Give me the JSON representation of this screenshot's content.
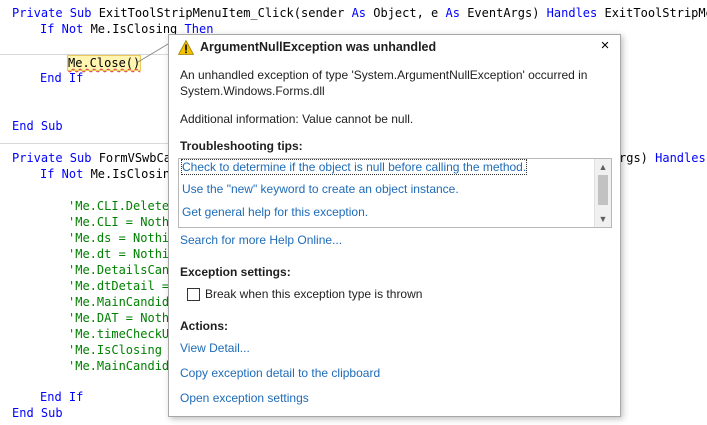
{
  "code": {
    "line1": {
      "kw1": "Private Sub",
      "name": " ExitToolStripMenuItem_Click(sender ",
      "kw2": "As",
      "t1": " Object, e ",
      "kw3": "As",
      "t2": " EventArgs) ",
      "kw4": "Handles",
      "t3": " ExitToolStripMenuI"
    },
    "line2": {
      "kw1": "If Not",
      "t1": " Me.IsClosing ",
      "kw2": "Then"
    },
    "line3": {
      "text": "Me.Close()"
    },
    "line4": {
      "kw": "End If"
    },
    "line5": {
      "kw": "End Sub"
    },
    "line6": {
      "kw1": "Private Sub",
      "name": " FormVSwbCar",
      "tail": "rgs) ",
      "kw2": "Handles"
    },
    "line7": {
      "kw1": "If Not",
      "t1": " Me.IsClosin"
    },
    "comments": [
      "'Me.CLI.Delete",
      "'Me.CLI = Nothi",
      "'Me.ds = Nothi",
      "'Me.dt = Nothin",
      "'Me.DetailsCan",
      "'Me.dtDetail =",
      "'Me.MainCandid",
      "'Me.DAT = Nothi",
      "'Me.timeCheckU",
      "'Me.IsClosing ",
      "'Me.MainCandid"
    ],
    "end_if": "End If",
    "end_sub": "End Sub"
  },
  "dialog": {
    "title": "ArgumentNullException was unhandled",
    "close_glyph": "×",
    "message": "An unhandled exception of type 'System.ArgumentNullException' occurred in System.Windows.Forms.dll",
    "additional": "Additional information: Value cannot be null.",
    "tips_heading": "Troubleshooting tips:",
    "tips": [
      "Check to determine if the object is null before calling the method.",
      "Use the \"new\" keyword to create an object instance.",
      "Get general help for this exception."
    ],
    "search_link": "Search for more Help Online...",
    "exception_settings_heading": "Exception settings:",
    "break_checkbox_label": "Break when this exception type is thrown",
    "break_checked": false,
    "actions_heading": "Actions:",
    "actions": [
      "View Detail...",
      "Copy exception detail to the clipboard",
      "Open exception settings"
    ]
  },
  "colors": {
    "keyword": "#0000ff",
    "comment": "#008000",
    "link": "#1e6bb8",
    "warning": "#f2c200"
  },
  "icons": {
    "warning": "warning-icon",
    "close": "close-icon"
  }
}
